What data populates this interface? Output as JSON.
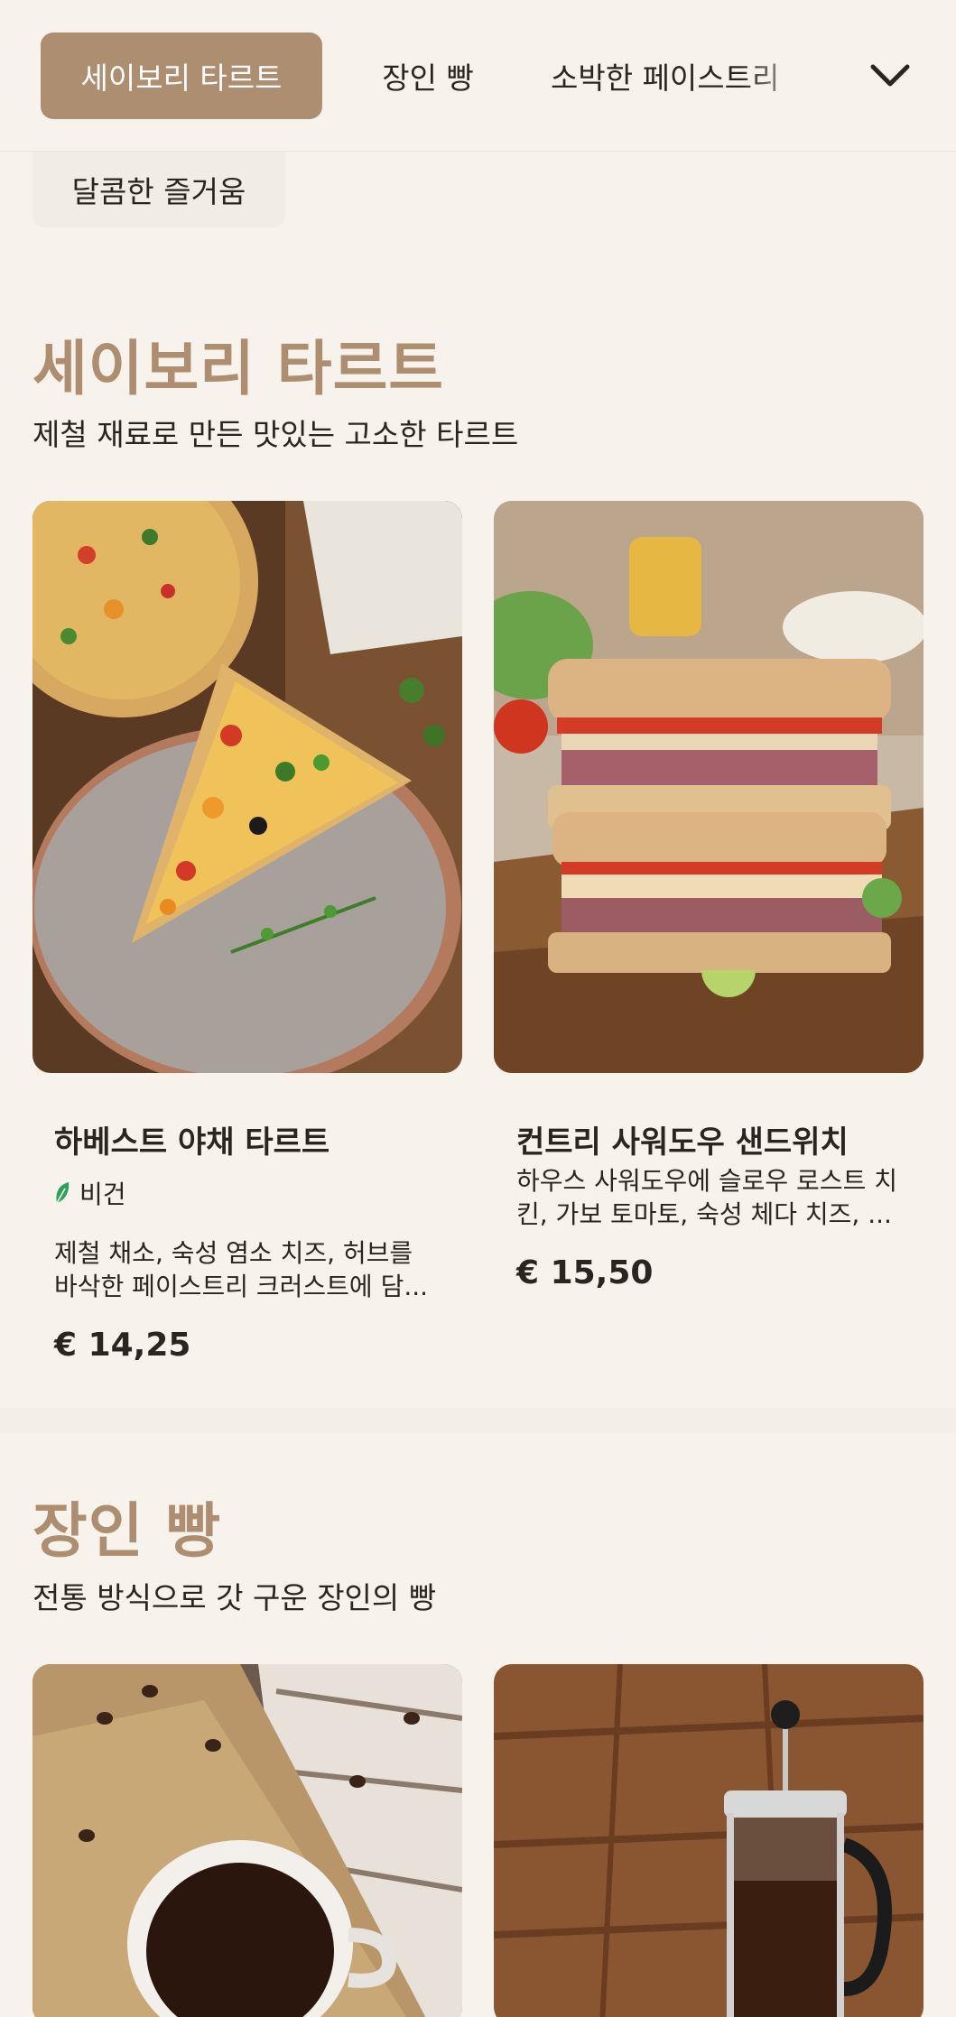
{
  "nav": {
    "tabs": [
      {
        "label": "세이보리 타르트",
        "active": true
      },
      {
        "label": "장인 빵",
        "active": false
      },
      {
        "label": "소박한 페이스트리",
        "active": false
      },
      {
        "label": "달콤한 즐거움",
        "active": false
      }
    ],
    "expand_icon": "chevron-down-icon"
  },
  "sections": [
    {
      "title": "세이보리 타르트",
      "subtitle": "제철 재료로 만든 맛있는 고소한 타르트",
      "products": [
        {
          "name": "하베스트 야채 타르트",
          "badge": "비건",
          "badge_icon": "leaf-icon",
          "description_line1": "제철 채소, 숙성 염소 치즈, 허브를",
          "description_line2": "바삭한 페이스트리 크러스트에 담...",
          "price": "€ 14,25"
        },
        {
          "name": "컨트리 사워도우 샌드위치",
          "description_line1": "하우스 사워도우에 슬로우 로스트 치",
          "description_line2": "킨, 가보 토마토, 숙성 체다 치즈, ...",
          "price": "€ 15,50"
        }
      ]
    },
    {
      "title": "장인 빵",
      "subtitle": "전통 방식으로 갓 구운 장인의 빵"
    }
  ],
  "colors": {
    "accent": "#ae8e70",
    "background": "#f7f2eb",
    "text": "#2b2521",
    "vegan_green": "#2fa05a"
  }
}
